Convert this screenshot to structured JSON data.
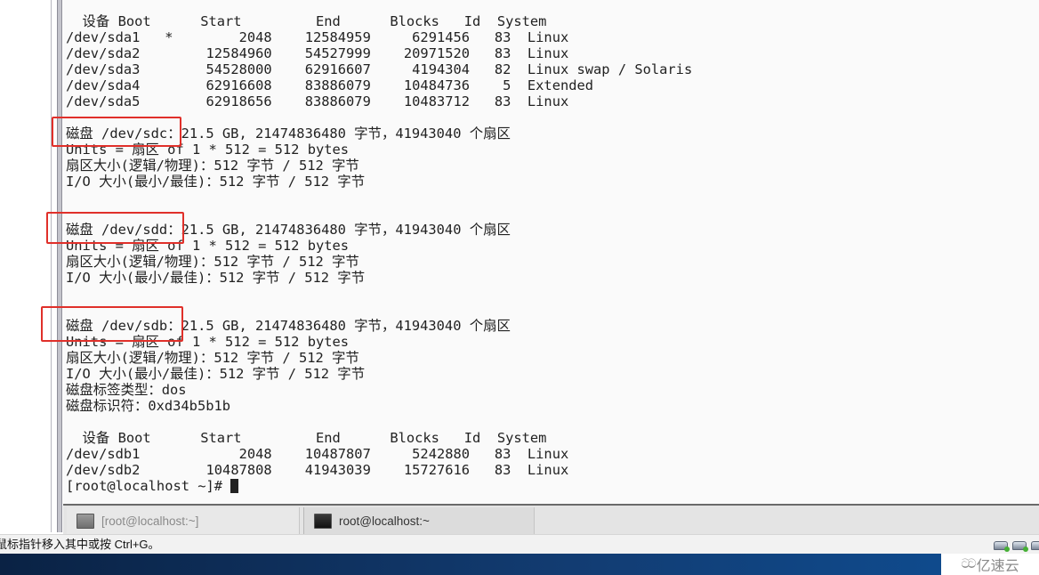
{
  "terminal": {
    "sda_table": {
      "header": "  设备 Boot      Start         End      Blocks   Id  System",
      "rows": [
        "/dev/sda1   *        2048    12584959     6291456   83  Linux",
        "/dev/sda2        12584960    54527999    20971520   83  Linux",
        "/dev/sda3        54528000    62916607     4194304   82  Linux swap / Solaris",
        "/dev/sda4        62916608    83886079    10484736    5  Extended",
        "/dev/sda5        62918656    83886079    10483712   83  Linux"
      ]
    },
    "disk_sdc": {
      "label": "磁盘 /dev/sdc",
      "summary": "：21.5 GB, 21474836480 字节，41943040 个扇区",
      "units": "Units = 扇区 of 1 * 512 = 512 bytes",
      "sector_size": "扇区大小(逻辑/物理)：512 字节 / 512 字节",
      "io_size": "I/O 大小(最小/最佳)：512 字节 / 512 字节"
    },
    "disk_sdd": {
      "label": "磁盘 /dev/sdd",
      "summary": "：21.5 GB, 21474836480 字节，41943040 个扇区",
      "units": "Units = 扇区 of 1 * 512 = 512 bytes",
      "sector_size": "扇区大小(逻辑/物理)：512 字节 / 512 字节",
      "io_size": "I/O 大小(最小/最佳)：512 字节 / 512 字节"
    },
    "disk_sdb": {
      "label": "磁盘 /dev/sdb",
      "summary": "：21.5 GB, 21474836480 字节，41943040 个扇区",
      "units": "Units = 扇区 of 1 * 512 = 512 bytes",
      "sector_size": "扇区大小(逻辑/物理)：512 字节 / 512 字节",
      "io_size": "I/O 大小(最小/最佳)：512 字节 / 512 字节",
      "label_type": "磁盘标签类型：dos",
      "identifier": "磁盘标识符：0xd34b5b1b"
    },
    "sdb_table": {
      "header": "  设备 Boot      Start         End      Blocks   Id  System",
      "rows": [
        "/dev/sdb1            2048    10487807     5242880   83  Linux",
        "/dev/sdb2        10487808    41943039    15727616   83  Linux"
      ]
    },
    "prompt": "[root@localhost ~]# "
  },
  "tabs": [
    {
      "label": "[root@localhost:~]",
      "icon": "terminal-icon",
      "active": false
    },
    {
      "label": "root@localhost:~",
      "icon": "terminal-icon",
      "active": true
    }
  ],
  "statusbar": {
    "hint": "鼠标指针移入其中或按 Ctrl+G。",
    "device_icons": [
      "hard-disk-icon",
      "hard-disk-icon",
      "hard-disk-icon"
    ]
  },
  "watermark": {
    "text": "亿速云",
    "icon": "cloud-logo-icon"
  },
  "colors": {
    "highlight_box": "#e0302a",
    "terminal_bg": "#fafafa",
    "terminal_fg": "#222222"
  }
}
